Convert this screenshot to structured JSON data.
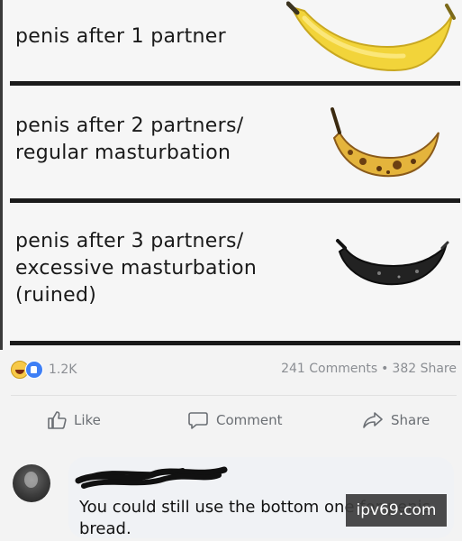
{
  "meme": {
    "panels": [
      {
        "text": "penis after 1 partner",
        "image": "fresh-yellow-banana"
      },
      {
        "text": "penis after 2 partners/\nregular masturbation",
        "image": "spotted-ripe-banana"
      },
      {
        "text": "penis after 3 partners/\nexcessive masturbation\n(ruined)",
        "image": "black-rotten-banana"
      }
    ]
  },
  "post_stats": {
    "reaction_icons": [
      "haha-reaction-icon",
      "like-reaction-icon"
    ],
    "reaction_count": "1.2K",
    "comments": "241 Comments",
    "separator": "•",
    "shares": "382 Share"
  },
  "actions": {
    "like_label": "Like",
    "comment_label": "Comment",
    "share_label": "Share"
  },
  "comment": {
    "text": "You could still use the bottom one for penis bread."
  },
  "watermark": "ipv69.com",
  "colors": {
    "meta_text": "#8b8e93",
    "action_text": "#6b6f74",
    "bubble": "#f0f2f5",
    "divider": "#1b1b1b"
  }
}
